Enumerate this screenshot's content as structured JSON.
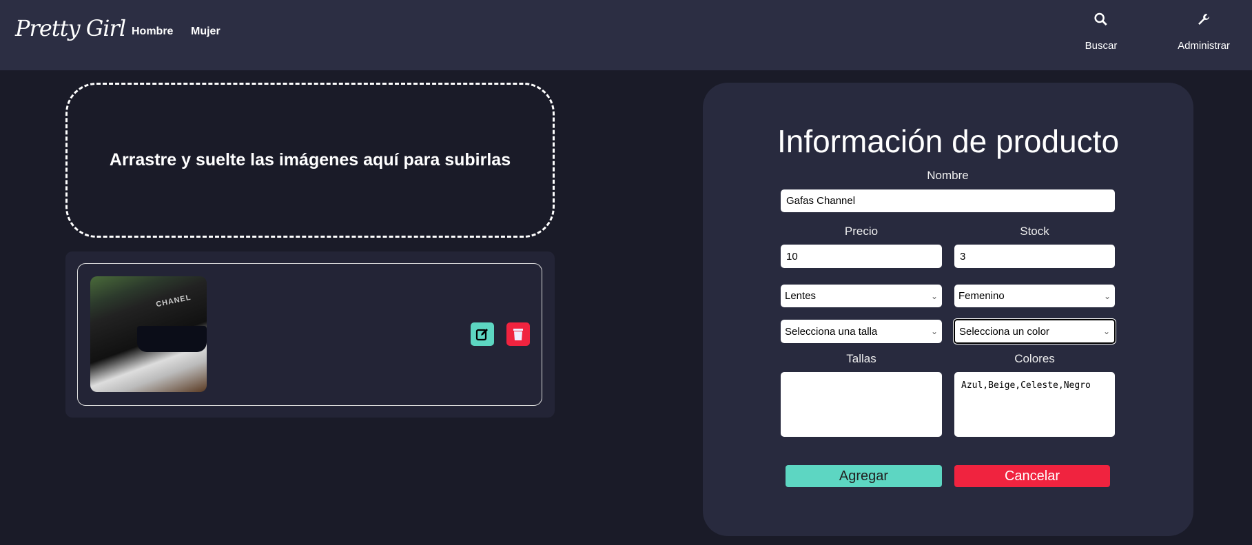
{
  "nav": {
    "logo": "Pretty Girl",
    "links": [
      "Hombre",
      "Mujer"
    ],
    "search": "Buscar",
    "admin": "Administrar",
    "search_icon": "search-icon",
    "admin_icon": "wrench-icon"
  },
  "upload": {
    "dropzone_text": "Arrastre y suelte las imágenes aquí para subirlas",
    "image_brand": "CHANEL"
  },
  "form": {
    "title": "Información de producto",
    "nombre_label": "Nombre",
    "nombre": "Gafas Channel",
    "precio_label": "Precio",
    "precio": "10",
    "stock_label": "Stock",
    "stock": "3",
    "categoria": "Lentes",
    "genero": "Femenino",
    "talla_select": "Selecciona una talla",
    "color_select": "Selecciona un color",
    "tallas_label": "Tallas",
    "tallas": "",
    "colores_label": "Colores",
    "colores": "Azul,Beige,Celeste,Negro",
    "agregar": "Agregar",
    "cancelar": "Cancelar"
  },
  "colors": {
    "accent": "#5dd6c2",
    "danger": "#f0233f",
    "nav": "#2c2e43",
    "background": "#1a1b28",
    "panel": "#282a3e"
  }
}
